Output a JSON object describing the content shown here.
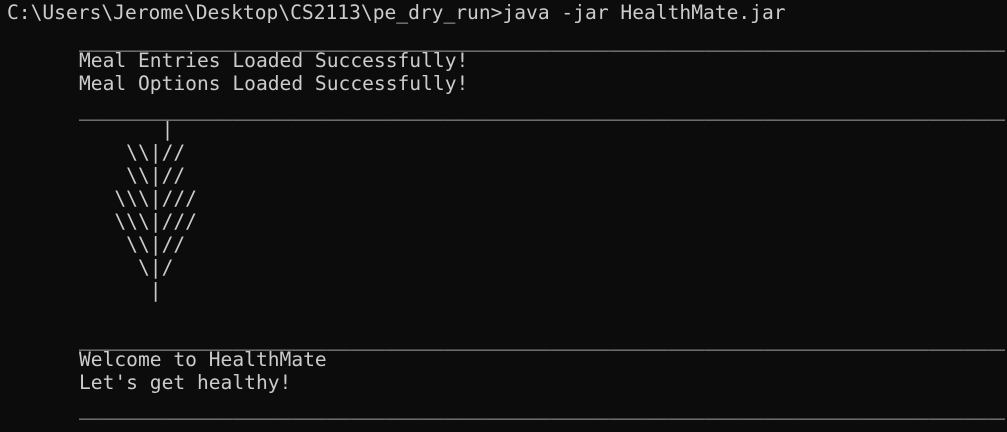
{
  "terminal": {
    "prompt_line": "C:\\Users\\Jerome\\Desktop\\CS2113\\pe_dry_run>java -jar HealthMate.jar",
    "separator": "_________________________________________________________________________________",
    "load_messages": [
      "Meal Entries Loaded Successfully!",
      "Meal Options Loaded Successfully!"
    ],
    "logo_lines": [
      "       |",
      "    \\\\|//",
      "    \\\\|//",
      "   \\\\\\|///",
      "   \\\\\\|///",
      "    \\\\|//",
      "     \\|/",
      "      |"
    ],
    "welcome_messages": [
      "Welcome to HealthMate",
      "Let's get healthy!"
    ]
  }
}
